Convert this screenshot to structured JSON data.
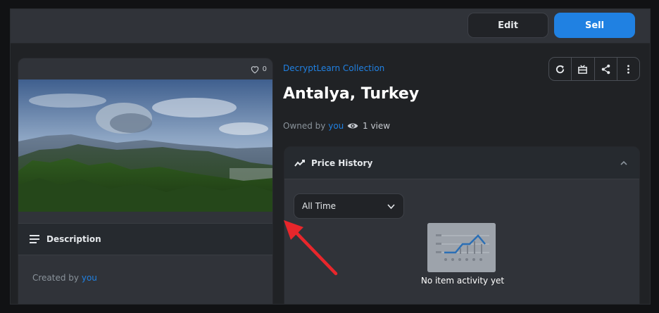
{
  "topbar": {
    "edit_label": "Edit",
    "sell_label": "Sell"
  },
  "item": {
    "favorites": "0",
    "collection": "DecryptLearn Collection",
    "title": "Antalya, Turkey",
    "owned_by_prefix": "Owned by",
    "owner": "you",
    "views": "1 view"
  },
  "description": {
    "title": "Description",
    "created_by_prefix": "Created by",
    "creator": "you"
  },
  "price_history": {
    "title": "Price History",
    "period": "All Time",
    "empty_text": "No item activity yet"
  },
  "toolbar": [
    "refresh-icon",
    "transfer-icon",
    "share-icon",
    "more-icon"
  ],
  "colors": {
    "accent": "#2081e2",
    "annotation_arrow": "#e8262b"
  }
}
